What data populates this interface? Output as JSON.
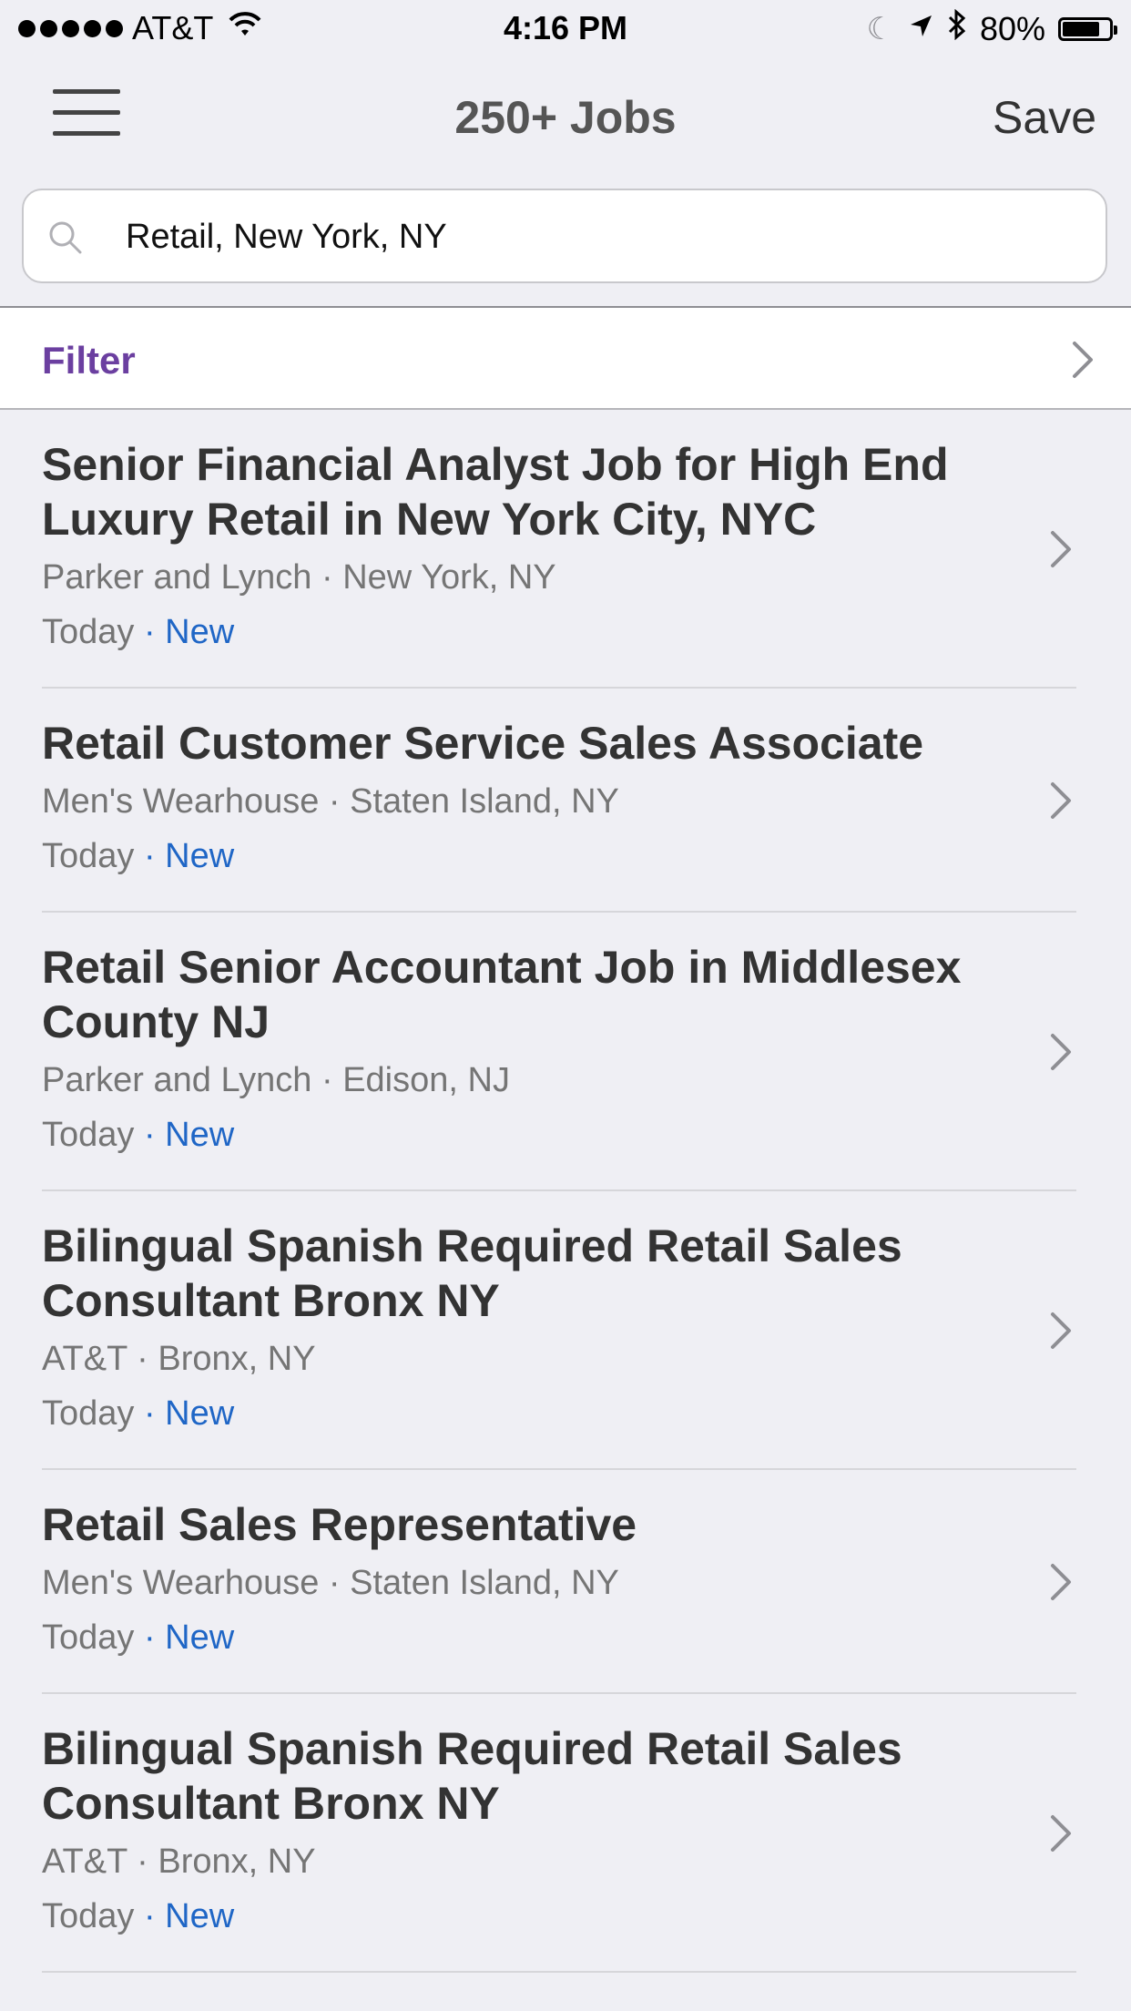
{
  "status_bar": {
    "carrier": "AT&T",
    "time": "4:16 PM",
    "battery": "80%",
    "battery_level": 0.8
  },
  "nav": {
    "title": "250+ Jobs",
    "save_label": "Save"
  },
  "search": {
    "value": "Retail, New York, NY"
  },
  "filter": {
    "label": "Filter"
  },
  "colors": {
    "accent_purple": "#6b3fa0",
    "new_blue": "#1f66c6"
  },
  "jobs": [
    {
      "title": "Senior Financial Analyst Job for High End Luxury Retail in New York City, NYC",
      "company_location": "Parker and Lynch · New York, NY",
      "date": "Today",
      "badge": " · New"
    },
    {
      "title": "Retail Customer Service Sales Associate",
      "company_location": "Men's Wearhouse · Staten Island, NY",
      "date": "Today",
      "badge": " · New"
    },
    {
      "title": "Retail Senior Accountant Job in Middlesex County NJ",
      "company_location": "Parker and Lynch · Edison, NJ",
      "date": "Today",
      "badge": " · New"
    },
    {
      "title": "Bilingual Spanish Required Retail Sales Consultant Bronx NY",
      "company_location": "AT&T · Bronx, NY",
      "date": "Today",
      "badge": " · New"
    },
    {
      "title": "Retail Sales Representative",
      "company_location": "Men's Wearhouse · Staten Island, NY",
      "date": "Today",
      "badge": " · New"
    },
    {
      "title": "Bilingual Spanish Required Retail Sales Consultant Bronx NY",
      "company_location": "AT&T · Bronx, NY",
      "date": "Today",
      "badge": " · New"
    }
  ]
}
